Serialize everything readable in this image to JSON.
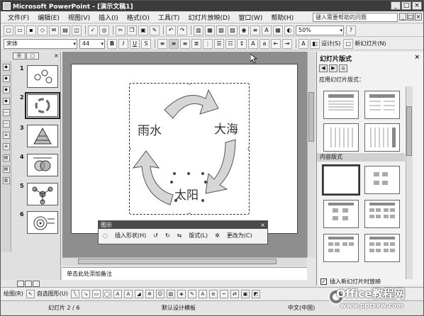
{
  "window": {
    "title": "Microsoft PowerPoint - [演示文稿1]",
    "controls": [
      "_",
      "□",
      "×"
    ]
  },
  "menubar": {
    "items": [
      "文件(F)",
      "编辑(E)",
      "视图(V)",
      "插入(I)",
      "格式(O)",
      "工具(T)",
      "幻灯片放映(D)",
      "窗口(W)",
      "帮助(H)"
    ],
    "help_box": "键入需要帮助的问题",
    "doc_controls": [
      "_",
      "□",
      "×"
    ]
  },
  "toolbar_standard": {
    "zoom": "50%",
    "design_label": "设计(S)"
  },
  "toolbar_format": {
    "font_name": "宋体",
    "font_size": "44",
    "bold": "B",
    "italic": "I",
    "underline": "U",
    "shadow": "S",
    "new_slide_label": "新幻灯片(N)"
  },
  "left_pane": {
    "tabs": [
      "☰",
      "▢"
    ],
    "close": "×",
    "thumbnails": [
      {
        "num": "1"
      },
      {
        "num": "2"
      },
      {
        "num": "3"
      },
      {
        "num": "4"
      },
      {
        "num": "5"
      },
      {
        "num": "6"
      }
    ]
  },
  "slide": {
    "labels": {
      "left": "雨水",
      "right": "大海",
      "bottom": "太阳"
    }
  },
  "diagram_toolbar": {
    "title": "图示",
    "close": "×",
    "insert_shape": "插入形状(H)",
    "layout": "版式(L)",
    "change_to": "更改为(C)"
  },
  "notes": {
    "placeholder": "单击此处添加备注"
  },
  "task_pane": {
    "title": "幻灯片版式",
    "close": "×",
    "section_applied": "应用幻灯片版式：",
    "section_content": "内容版式",
    "checkbox_label": "插入新幻灯片时放映",
    "checkbox_checked": true
  },
  "drawing_toolbar": {
    "draw_label": "绘图(R)",
    "autoshape_label": "自选图形(U)"
  },
  "status_bar": {
    "slide_info": "幻灯片 2 / 6",
    "design": "默认设计模板",
    "language": "中文(中国)"
  },
  "watermark": {
    "brand": "Office教程网",
    "url": "www.pptxxw.com"
  }
}
